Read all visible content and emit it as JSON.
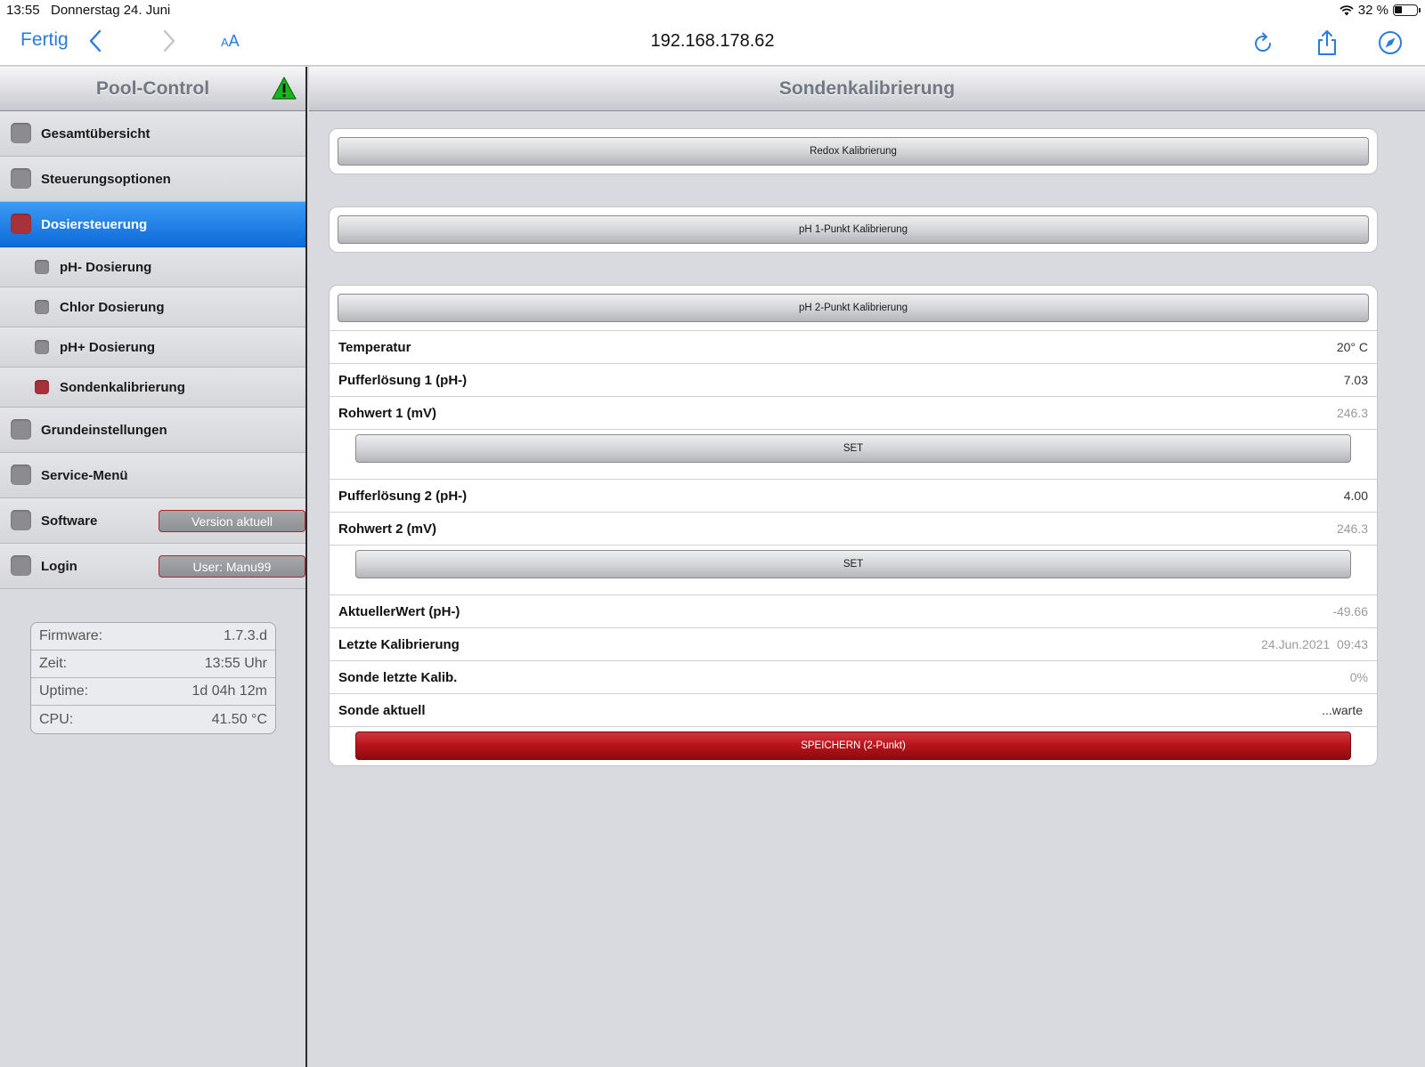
{
  "status": {
    "time": "13:55",
    "date": "Donnerstag 24. Juni",
    "battery": "32 %"
  },
  "browser": {
    "done": "Fertig",
    "aa_small": "A",
    "aa_big": "A",
    "url": "192.168.178.62"
  },
  "sidebar": {
    "title": "Pool-Control",
    "items": [
      {
        "label": "Gesamtübersicht"
      },
      {
        "label": "Steuerungsoptionen"
      },
      {
        "label": "Dosiersteuerung"
      },
      {
        "label": "pH- Dosierung"
      },
      {
        "label": "Chlor Dosierung"
      },
      {
        "label": "pH+ Dosierung"
      },
      {
        "label": "Sondenkalibrierung"
      },
      {
        "label": "Grundeinstellungen"
      },
      {
        "label": "Service-Menü"
      },
      {
        "label": "Software",
        "badge": "Version aktuell"
      },
      {
        "label": "Login",
        "badge": "User: Manu99"
      }
    ],
    "info": [
      {
        "key": "Firmware:",
        "value": "1.7.3.d"
      },
      {
        "key": "Zeit:",
        "value": "13:55 Uhr"
      },
      {
        "key": "Uptime:",
        "value": "1d 04h 12m"
      },
      {
        "key": "CPU:",
        "value": "41.50 °C"
      }
    ]
  },
  "main": {
    "title": "Sondenkalibrierung",
    "redox_button": "Redox Kalibrierung",
    "ph1_button": "pH 1-Punkt Kalibrierung",
    "ph2_button": "pH 2-Punkt Kalibrierung",
    "rows": {
      "temp": {
        "key": "Temperatur",
        "value": "20° C"
      },
      "buffer1": {
        "key": "Pufferlösung 1 (pH-)",
        "value": "7.03"
      },
      "raw1": {
        "key": "Rohwert 1 (mV)",
        "value": "246.3"
      },
      "buffer2": {
        "key": "Pufferlösung 2 (pH-)",
        "value": "4.00"
      },
      "raw2": {
        "key": "Rohwert 2 (mV)",
        "value": "246.3"
      },
      "current": {
        "key": "AktuellerWert (pH-)",
        "value": "-49.66"
      },
      "last_cal": {
        "key": "Letzte Kalibrierung",
        "value": "24.Jun.2021  09:43"
      },
      "probe_last": {
        "key": "Sonde letzte Kalib.",
        "value": "0%"
      },
      "probe_now": {
        "key": "Sonde aktuell",
        "value": "...warte"
      }
    },
    "set_label": "SET",
    "save_label": "SPEICHERN (2-Punkt)"
  },
  "colors": {
    "accent": "#2a7bde",
    "active_nav": "#1577e6",
    "led_red": "#a8323a",
    "save_red": "#b6131b"
  }
}
